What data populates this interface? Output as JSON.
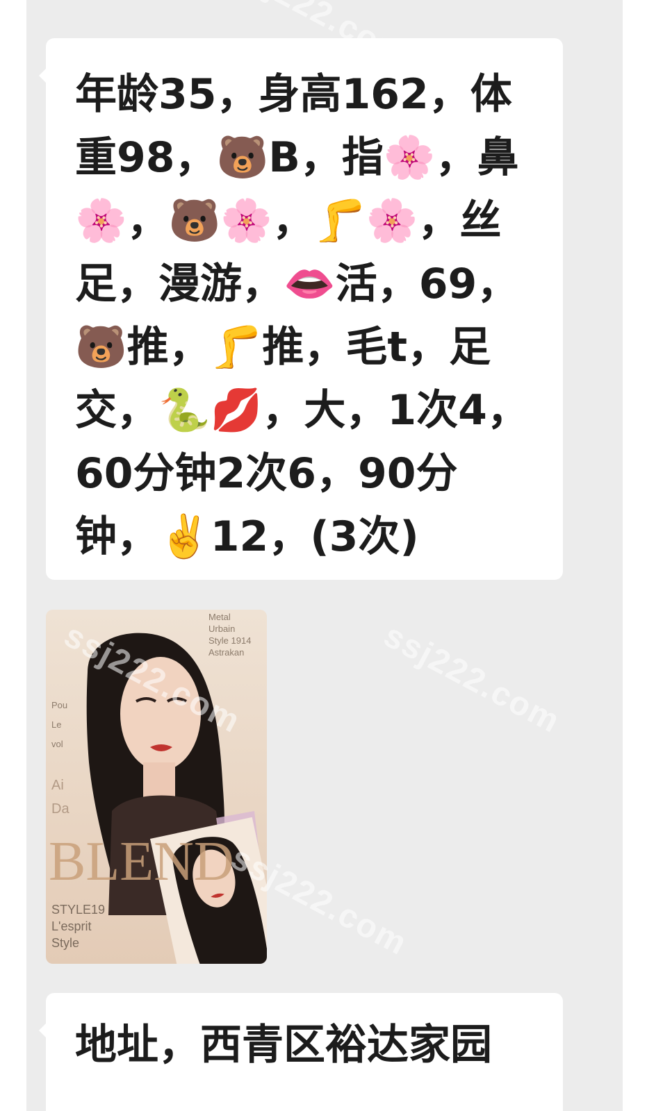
{
  "messages": [
    {
      "text": "年龄35，身高162，体重98，🐻B，指🌸，鼻🌸，🐻🌸，🦵🌸，丝足，漫游，👄活，69，🐻推，🦵推，毛t，足交，🐍💋，大，1次4，60分钟2次6，90分钟，✌️12，(3次)"
    },
    {
      "photo": {
        "magazine_text_top": "Metal\nUrbain\nStyle 1914\nAstrakan",
        "magazine_text_left": "Pou\nLe\nvol",
        "magazine_text_mid": "Ai\nDa",
        "magazine_big_word": "BLEND",
        "magazine_text_bottom": "STYLE19\nL'esprit\nStyle"
      }
    },
    {
      "text": "地址，西青区裕达家园"
    }
  ],
  "watermark_text": "ssj222.com",
  "colors": {
    "chat_bg": "#ececec",
    "bubble_bg": "#ffffff",
    "text": "#1c1c1c"
  }
}
